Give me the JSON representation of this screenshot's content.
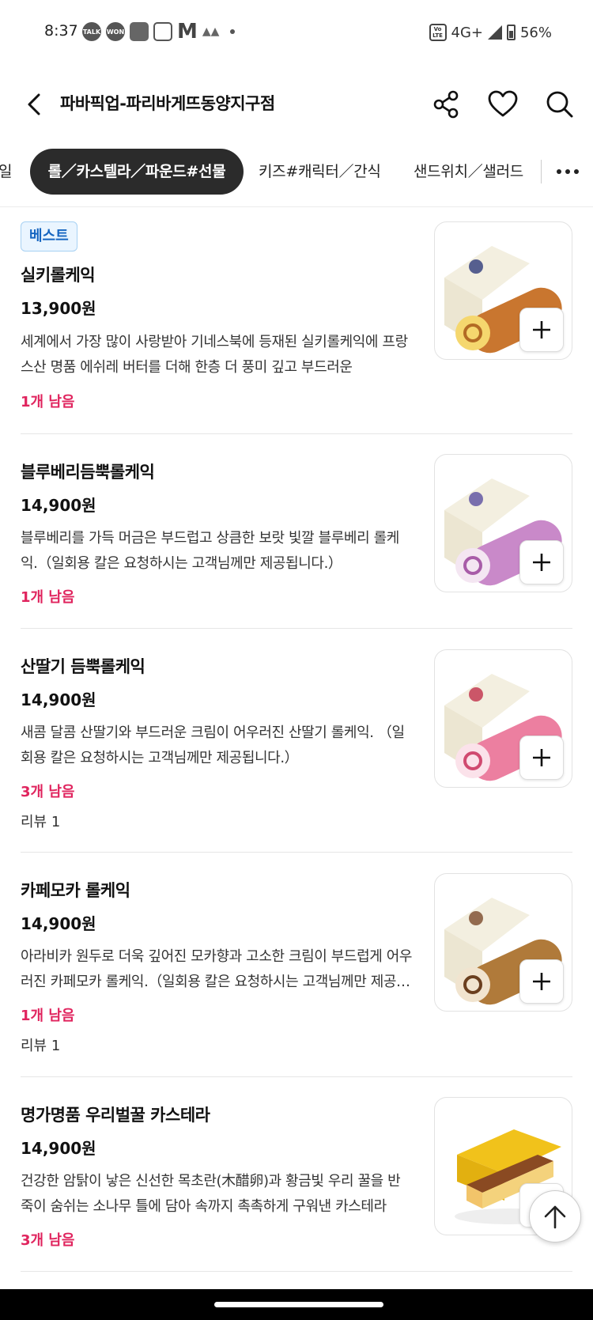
{
  "status_bar": {
    "time": "8:37",
    "left_icons": [
      "TALK",
      "WON",
      "",
      "",
      "M"
    ],
    "network": "4G+",
    "battery": "56%"
  },
  "header": {
    "title": "파바픽업-파리바게뜨동양지구점"
  },
  "tabs": [
    {
      "label": "일"
    },
    {
      "label": "롤／카스텔라／파운드#선물"
    },
    {
      "label": "키즈#캐릭터／간식"
    },
    {
      "label": "샌드위치／샐러드"
    }
  ],
  "products": [
    {
      "badge": "베스트",
      "name": "실키롤케익",
      "price": "13,900원",
      "description": "세계에서 가장 많이 사랑받아 기네스북에 등재된 실키롤케익에 프랑스산 명품 에쉬레 버터를 더해 한층 더 풍미 깊고 부드러운",
      "stock": "1개 남음",
      "review": "",
      "cake_color": "#c9762f"
    },
    {
      "badge": "",
      "name": "블루베리듬뿍롤케익",
      "price": "14,900원",
      "description": "블루베리를 가득 머금은 부드럽고 상큼한 보랏 빛깔 블루베리 롤케익.（일회용 칼은 요청하시는 고객님께만 제공됩니다.）",
      "stock": "1개 남음",
      "review": "",
      "cake_color": "#c989c9"
    },
    {
      "badge": "",
      "name": "산딸기 듬뿍롤케익",
      "price": "14,900원",
      "description": "새콤 달콤 산딸기와 부드러운 크림이 어우러진 산딸기 롤케익. （일회용 칼은 요청하시는 고객님께만 제공됩니다.）",
      "stock": "3개 남음",
      "review": "리뷰 1",
      "cake_color": "#ec7fa0"
    },
    {
      "badge": "",
      "name": "카페모카 롤케익",
      "price": "14,900원",
      "description": "아라비카 원두로 더욱 깊어진 모카향과 고소한 크림이 부드럽게 어우러진 카페모카 롤케익.（일회용 칼은 요청하시는 고객님께만 제공됩니다.）",
      "stock": "1개 남음",
      "review": "리뷰 1",
      "cake_color": "#b07a3a"
    },
    {
      "badge": "",
      "name": "명가명품 우리벌꿀 카스테라",
      "price": "14,900원",
      "description": "건강한 암탉이 낳은 신선한 목초란(木醋卵)과 황금빛 우리 꿀을 반죽이 숨쉬는 소나무 틀에 담아 속까지 촉촉하게 구워낸 카스테라",
      "stock": "3개 남음",
      "review": "",
      "cake_color": "#8a4a22"
    }
  ]
}
